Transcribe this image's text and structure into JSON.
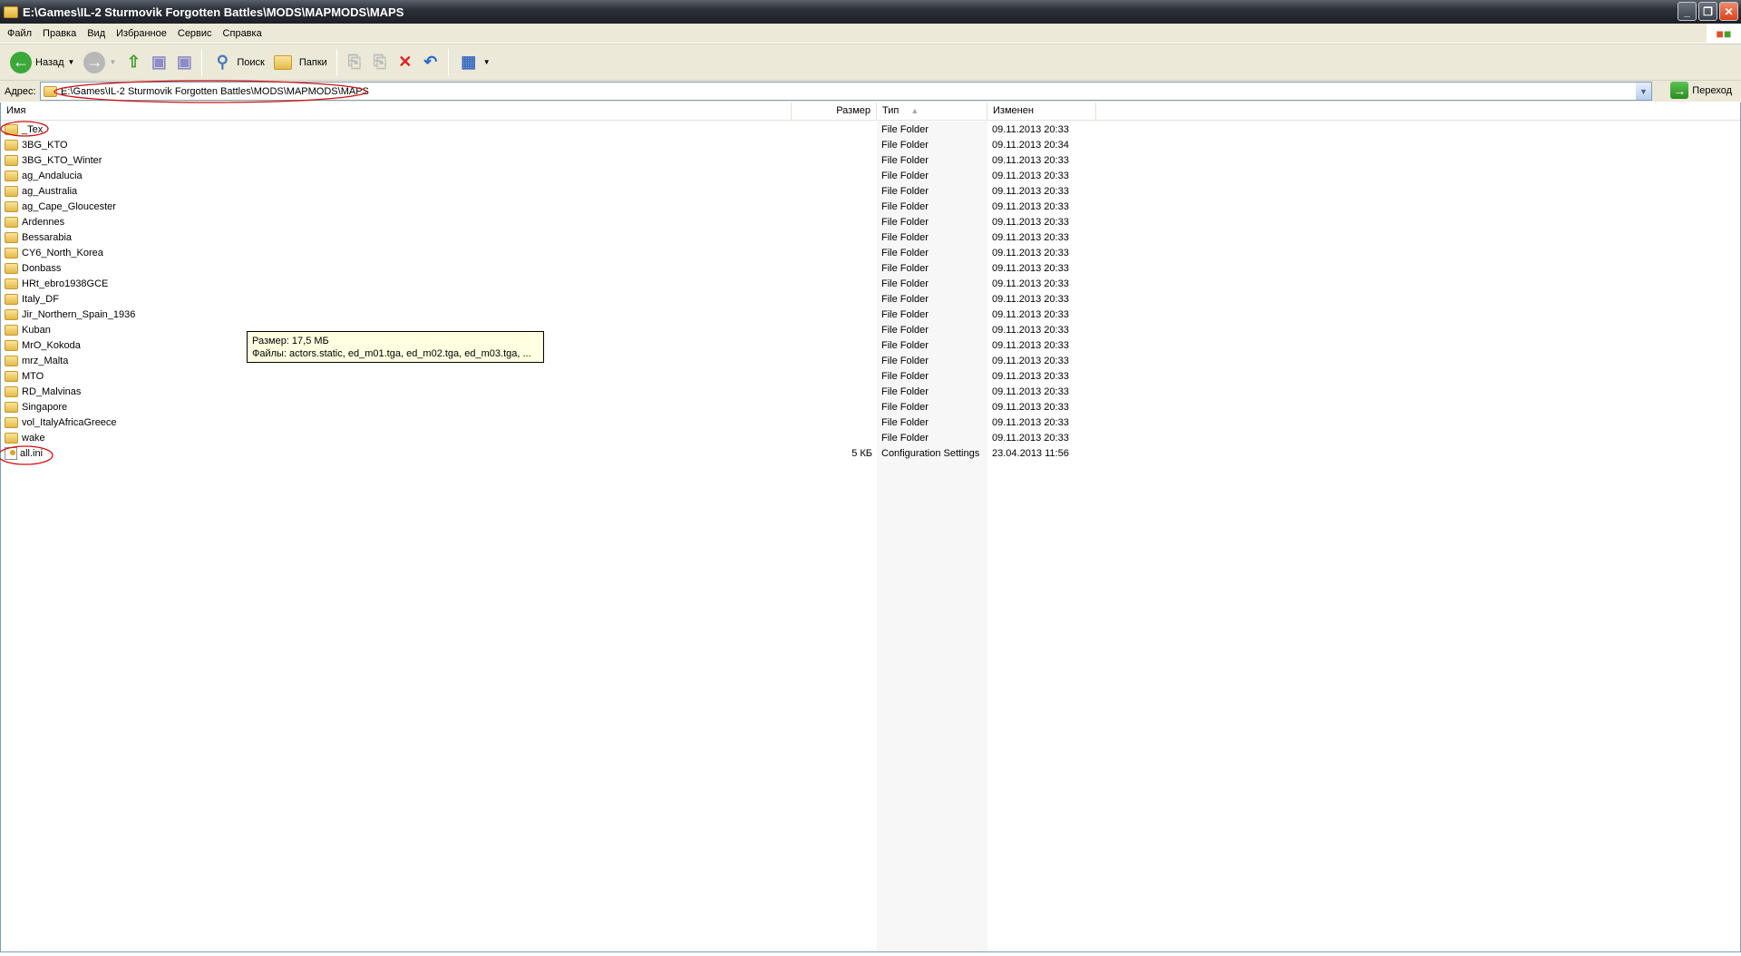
{
  "window": {
    "title": "E:\\Games\\IL-2 Sturmovik Forgotten Battles\\MODS\\MAPMODS\\MAPS"
  },
  "menu": [
    "Файл",
    "Правка",
    "Вид",
    "Избранное",
    "Сервис",
    "Справка"
  ],
  "toolbar": {
    "back": "Назад",
    "search": "Поиск",
    "folders": "Папки"
  },
  "address": {
    "label": "Адрес:",
    "value": "E:\\Games\\IL-2 Sturmovik Forgotten Battles\\MODS\\MAPMODS\\MAPS",
    "go": "Переход"
  },
  "columns": {
    "name": "Имя",
    "size": "Размер",
    "type": "Тип",
    "modified": "Изменен"
  },
  "files": [
    {
      "name": "_Tex",
      "size": "",
      "type": "File Folder",
      "modified": "09.11.2013 20:33"
    },
    {
      "name": "3BG_KTO",
      "size": "",
      "type": "File Folder",
      "modified": "09.11.2013 20:34"
    },
    {
      "name": "3BG_KTO_Winter",
      "size": "",
      "type": "File Folder",
      "modified": "09.11.2013 20:33"
    },
    {
      "name": "ag_Andalucia",
      "size": "",
      "type": "File Folder",
      "modified": "09.11.2013 20:33"
    },
    {
      "name": "ag_Australia",
      "size": "",
      "type": "File Folder",
      "modified": "09.11.2013 20:33"
    },
    {
      "name": "ag_Cape_Gloucester",
      "size": "",
      "type": "File Folder",
      "modified": "09.11.2013 20:33"
    },
    {
      "name": "Ardennes",
      "size": "",
      "type": "File Folder",
      "modified": "09.11.2013 20:33"
    },
    {
      "name": "Bessarabia",
      "size": "",
      "type": "File Folder",
      "modified": "09.11.2013 20:33"
    },
    {
      "name": "CY6_North_Korea",
      "size": "",
      "type": "File Folder",
      "modified": "09.11.2013 20:33"
    },
    {
      "name": "Donbass",
      "size": "",
      "type": "File Folder",
      "modified": "09.11.2013 20:33"
    },
    {
      "name": "HRt_ebro1938GCE",
      "size": "",
      "type": "File Folder",
      "modified": "09.11.2013 20:33"
    },
    {
      "name": "Italy_DF",
      "size": "",
      "type": "File Folder",
      "modified": "09.11.2013 20:33"
    },
    {
      "name": "Jir_Northern_Spain_1936",
      "size": "",
      "type": "File Folder",
      "modified": "09.11.2013 20:33"
    },
    {
      "name": "Kuban",
      "size": "",
      "type": "File Folder",
      "modified": "09.11.2013 20:33"
    },
    {
      "name": "MrO_Kokoda",
      "size": "",
      "type": "File Folder",
      "modified": "09.11.2013 20:33"
    },
    {
      "name": "mrz_Malta",
      "size": "",
      "type": "File Folder",
      "modified": "09.11.2013 20:33"
    },
    {
      "name": "MTO",
      "size": "",
      "type": "File Folder",
      "modified": "09.11.2013 20:33"
    },
    {
      "name": "RD_Malvinas",
      "size": "",
      "type": "File Folder",
      "modified": "09.11.2013 20:33"
    },
    {
      "name": "Singapore",
      "size": "",
      "type": "File Folder",
      "modified": "09.11.2013 20:33"
    },
    {
      "name": "vol_ItalyAfricaGreece",
      "size": "",
      "type": "File Folder",
      "modified": "09.11.2013 20:33"
    },
    {
      "name": "wake",
      "size": "",
      "type": "File Folder",
      "modified": "09.11.2013 20:33"
    },
    {
      "name": "all.ini",
      "size": "5 КБ",
      "type": "Configuration Settings",
      "modified": "23.04.2013 11:56"
    }
  ],
  "tooltip": {
    "line1": "Размер: 17,5 МБ",
    "line2": "Файлы: actors.static, ed_m01.tga, ed_m02.tga, ed_m03.tga, ..."
  }
}
